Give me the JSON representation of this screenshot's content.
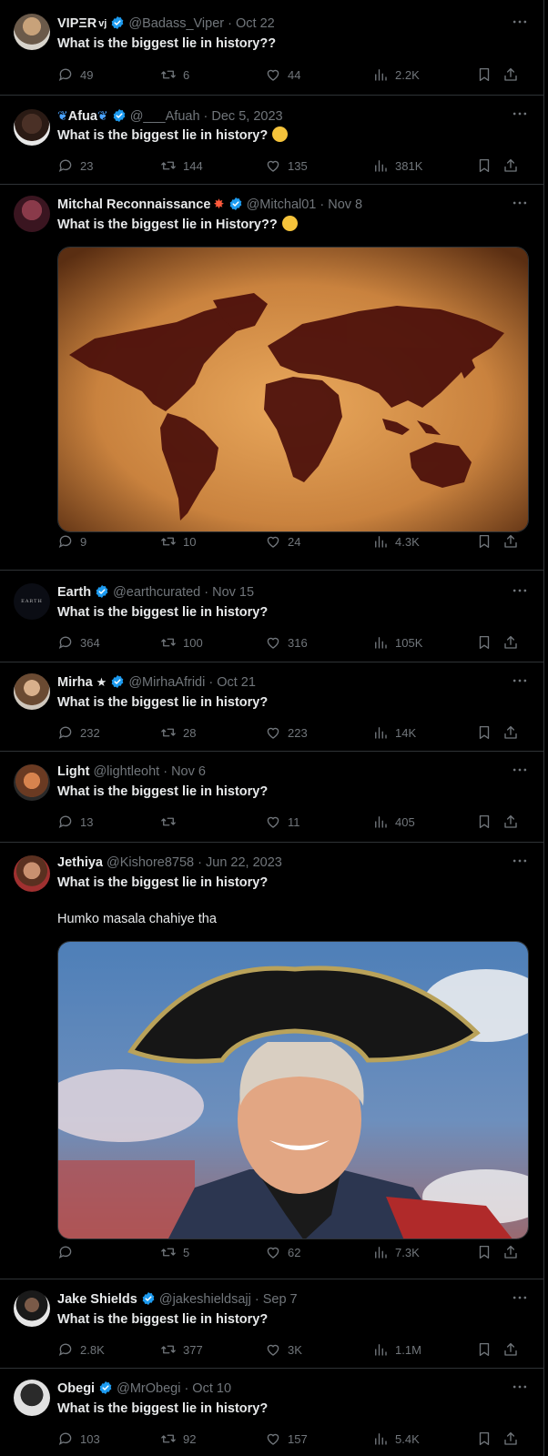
{
  "colors": {
    "background": "#000000",
    "text": "#e7e9ea",
    "muted": "#71767b",
    "verified": "#1d9bf0",
    "divider": "#2f3336"
  },
  "tweets": [
    {
      "name": "VIPΞR",
      "badge": "vj",
      "handle": "@Badass_Viper · Oct 22",
      "text": "What is the biggest lie in history??",
      "replies": "49",
      "retweets": "6",
      "likes": "44",
      "views": "2.2K"
    },
    {
      "name": "Afua",
      "handle": "@___Afuah · Dec 5, 2023",
      "text": "What is the biggest lie in history?",
      "replies": "23",
      "retweets": "144",
      "likes": "135",
      "views": "381K"
    },
    {
      "name": "Mitchal Reconnaissance",
      "handle": "@Mitchal01 · Nov 8",
      "text": "What is the biggest lie in History??",
      "replies": "9",
      "retweets": "10",
      "likes": "24",
      "views": "4.3K"
    },
    {
      "name": "Earth",
      "avatar_label": "EARTH",
      "handle": "@earthcurated · Nov 15",
      "text": "What is the biggest lie in history?",
      "replies": "364",
      "retweets": "100",
      "likes": "316",
      "views": "105K"
    },
    {
      "name": "Mirha",
      "handle": "@MirhaAfridi · Oct 21",
      "text": "What is the biggest lie in history?",
      "replies": "232",
      "retweets": "28",
      "likes": "223",
      "views": "14K"
    },
    {
      "name": "Light",
      "handle": "@lightleoht · Nov 6",
      "text": "What is the biggest lie in history?",
      "replies": "13",
      "retweets": "",
      "likes": "11",
      "views": "405"
    },
    {
      "name": "Jethiya",
      "handle": "@Kishore8758 · Jun 22, 2023",
      "text": "What is the biggest lie in history?",
      "extra": "Humko masala chahiye tha",
      "replies": "",
      "retweets": "5",
      "likes": "62",
      "views": "7.3K"
    },
    {
      "name": "Jake Shields",
      "handle": "@jakeshieldsajj · Sep 7",
      "text": "What is the biggest lie in history?",
      "replies": "2.8K",
      "retweets": "377",
      "likes": "3K",
      "views": "1.1M"
    },
    {
      "name": "Obegi",
      "handle": "@MrObegi · Oct 10",
      "text": "What is the biggest lie in history?",
      "replies": "103",
      "retweets": "92",
      "likes": "157",
      "views": "5.4K"
    }
  ]
}
